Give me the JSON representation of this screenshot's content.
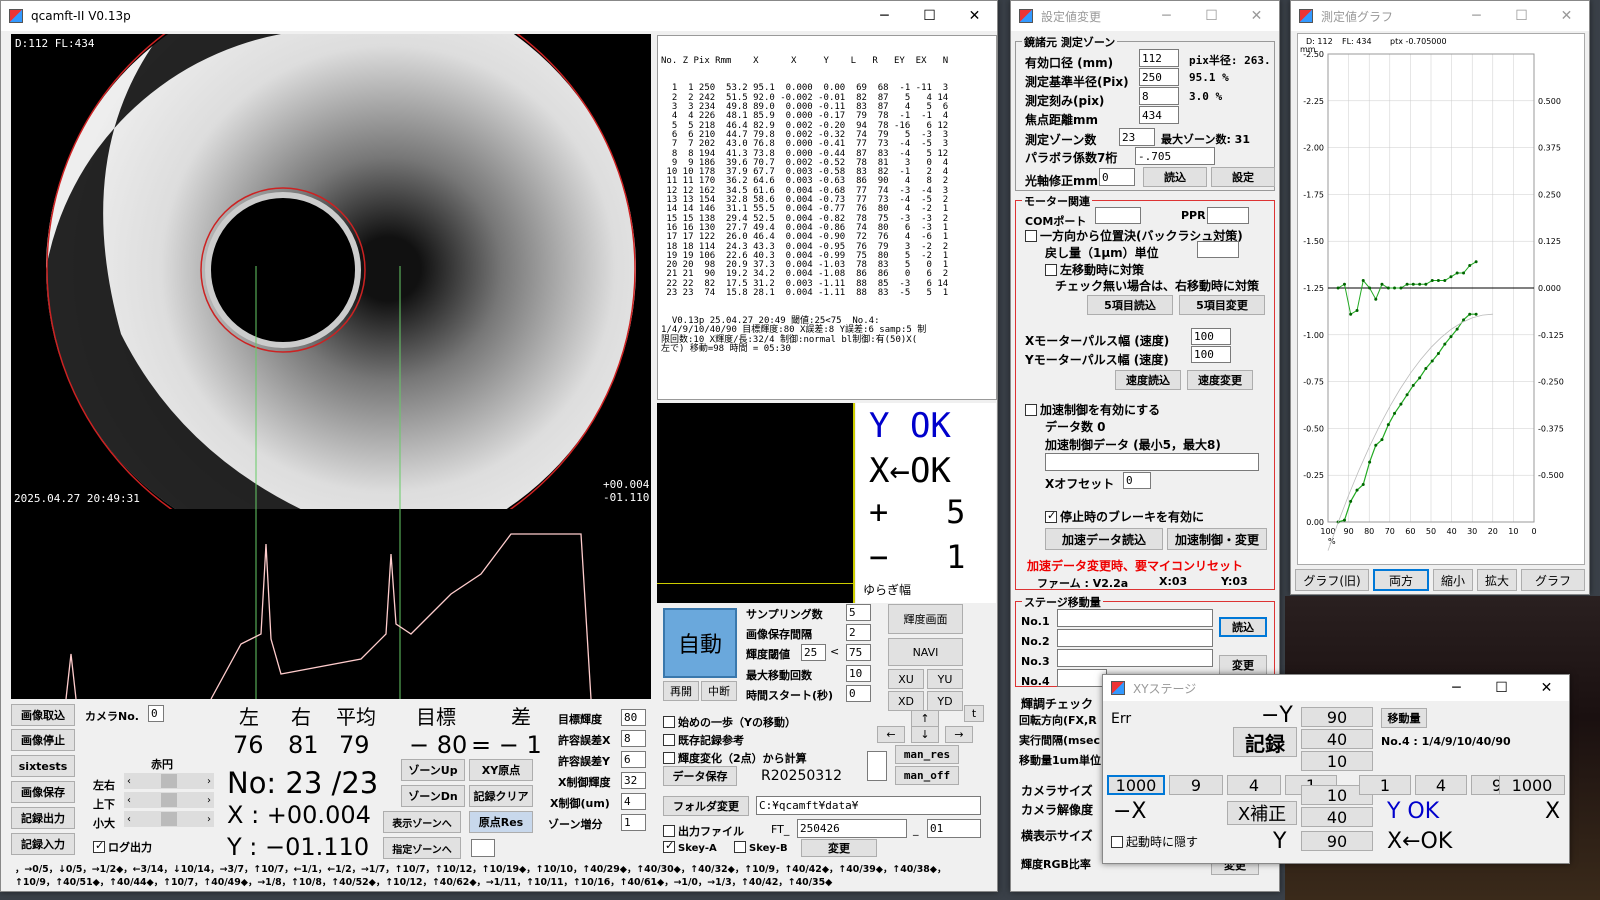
{
  "main": {
    "title": "qcamft-II  V0.13p",
    "cam_overlay": "D:112 FL:434",
    "timestamp": "2025.04.27 20:49:31",
    "xy_overlay1": "+00.004",
    "xy_overlay2": "-01.110",
    "table_header": "No. Z Pix Rmm    X      X     Y    L   R   EY  EX   N",
    "table_rows": [
      "  1  1 250  53.2 95.1  0.000  0.00  69  68  -1 -11  3",
      "  2  2 242  51.5 92.0 -0.002 -0.01  82  87   5   4 14",
      "  3  3 234  49.8 89.0  0.000 -0.11  83  87   4   5  6",
      "  4  4 226  48.1 85.9  0.000 -0.17  79  78  -1  -1  4",
      "  5  5 218  46.4 82.9  0.002 -0.20  94  78 -16   6 12",
      "  6  6 210  44.7 79.8  0.002 -0.32  74  79   5  -3  3",
      "  7  7 202  43.0 76.8  0.000 -0.41  77  73  -4  -5  3",
      "  8  8 194  41.3 73.8  0.000 -0.44  87  83  -4   5 12",
      "  9  9 186  39.6 70.7  0.002 -0.52  78  81   3   0  4",
      " 10 10 178  37.9 67.7  0.003 -0.58  83  82  -1   2  4",
      " 11 11 170  36.2 64.6  0.003 -0.63  86  90   4   8  2",
      " 12 12 162  34.5 61.6  0.004 -0.68  77  74  -3  -4  3",
      " 13 13 154  32.8 58.6  0.004 -0.73  77  73  -4  -5  2",
      " 14 14 146  31.1 55.5  0.004 -0.77  76  80   4  -2  1",
      " 15 15 138  29.4 52.5  0.004 -0.82  78  75  -3  -3  2",
      " 16 16 130  27.7 49.4  0.004 -0.86  74  80   6  -3  1",
      " 17 17 122  26.0 46.4  0.004 -0.90  72  76   4  -6  1",
      " 18 18 114  24.3 43.3  0.004 -0.95  76  79   3  -2  2",
      " 19 19 106  22.6 40.3  0.004 -0.99  75  80   5  -2  1",
      " 20 20  98  20.9 37.3  0.004 -1.03  78  83   5   0  1",
      " 21 21  90  19.2 34.2  0.004 -1.08  86  86   0   6  2",
      " 22 22  82  17.5 31.2  0.003 -1.11  88  85  -3   6 14",
      " 23 23  74  15.8 28.1  0.004 -1.11  88  83  -5   5  1"
    ],
    "table_footer": [
      "  V0.13p 25.04.27 20:49 閾値:25<75  No.4:",
      "1/4/9/10/40/90 目標輝度:80 X誤差:8 Y誤差:6 samp:5 制",
      "限回数:10 X輝度/長:32/4 制御:normal bl制御:有(50)X(",
      "左で) 移動=98 時間 = 05:30"
    ],
    "status_y": "Y OK",
    "status_x": "X←OK",
    "plus": "+   5",
    "minus": "−   1",
    "yuragi": "ゆらぎ幅",
    "auto": "自動",
    "restart": "再開",
    "pause": "中断",
    "sampling": "サンプリング数",
    "sampling_v": "5",
    "imgint": "画像保存間隔",
    "imgint_v": "2",
    "thr": "輝度閾値",
    "thr_a": "25",
    "thr_b": "75",
    "maxmove": "最大移動回数",
    "maxmove_v": "10",
    "timestart": "時間スタート(秒)",
    "timestart_v": "0",
    "brightscr": "輝度画面",
    "navi": "NAVI",
    "xu": "XU",
    "yu": "YU",
    "xd": "XD",
    "yd": "YD",
    "cap": "画像取込",
    "stop": "画像停止",
    "sixtests": "sixtests",
    "save": "画像保存",
    "recout": "記録出力",
    "recin": "記録入力",
    "camno": "カメラNo.",
    "camno_v": "0",
    "sekien": "赤円",
    "lr": "左右",
    "ud": "上下",
    "sz": "小大",
    "logout": "ログ出力",
    "h_left": "左",
    "h_right": "右",
    "h_avg": "平均",
    "h_target": "目標",
    "h_diff": "差",
    "v_left": "76",
    "v_right": "81",
    "v_avg": "79",
    "v_target": "− 80",
    "v_diff": "= − 1",
    "no": "No: 23 /23",
    "x": "X : +00.004",
    "y": "Y : −01.110",
    "zoneup": "ゾーンUp",
    "zonedn": "ゾーンDn",
    "xyorig": "XY原点",
    "recclr": "記録クリア",
    "showzone": "表示ゾーンへ",
    "origres": "原点Res",
    "specz": "指定ゾーンへ",
    "tb": "目標輝度",
    "tb_v": "80",
    "ex": "許容誤差X",
    "ex_v": "8",
    "ey": "許容誤差Y",
    "ey_v": "6",
    "xc": "X制御輝度",
    "xc_v": "32",
    "xcu": "X制御(um)",
    "xcu_v": "4",
    "zinc": "ゾーン増分",
    "zinc_v": "1",
    "first": "始めの一歩（Yの移動）",
    "exist": "既存記録参考",
    "bchg": "輝度変化（2点）から計算",
    "datasave": "データ保存",
    "rdate": "R20250312",
    "manres": "man_res",
    "manoff": "man_off",
    "up": "↑",
    "dn": "↓",
    "lf": "←",
    "rt": "→",
    "t": "t",
    "folder": "フォルダ変更",
    "folder_v": "C:¥qcamft¥data¥",
    "outfile": "出力ファイル",
    "ft": "FT_",
    "ft_v": "250426",
    "ft_n": "01",
    "skeya": "Skey-A",
    "skeyb": "Skey-B",
    "change": "変更",
    "log": "，→0/5，↓0/5，→1/2◆，←3/14，↓10/14，→3/7，↑10/7，←1/1，←1/2，→1/7，↑10/7，↑10/12，↑10/19◆，↑10/10，↑40/29◆，↑40/30◆，↑40/32◆，↑10/9，↑40/42◆，↑40/39◆，↑40/38◆，↑10/9，↑40/51◆，↑40/44◆，↑10/7，↑40/49◆，→1/8，↑10/8，↑40/52◆，↑10/12，↑40/62◆，→1/11，↑10/11，↑10/16，↑40/61◆，→1/0，→1/3，↑40/42，↑40/35◆"
  },
  "settings": {
    "title": "設定値変更",
    "g1": "鏡諸元 測定ゾーン",
    "eff": "有効口径 (mm)",
    "eff_v": "112",
    "pixr": "pix半径: 263.",
    "base": "測定基準半径(Pix)",
    "base_v": "250",
    "base_p": "95.1 %",
    "step": "測定刻み(pix)",
    "step_v": "8",
    "step_p": "3.0 %",
    "fl": "焦点距離mm",
    "fl_v": "434",
    "zones": "測定ゾーン数",
    "zones_v": "23",
    "maxz": "最大ゾーン数:  31",
    "para": "パラボラ係数7桁",
    "para_v": "-.705",
    "axis": "光軸修正mm",
    "axis_v": "0",
    "read": "読込",
    "set": "設定",
    "g2": "モーター関連",
    "com": "COMポート",
    "ppr": "PPR",
    "oneway": "一方向から位置決(バックラシュ対策)",
    "ret": "戻し量（1μm）単位",
    "leftmv": "左移動時に対策",
    "note": "チェック無い場合は、右移動時に対策",
    "r5": "5項目読込",
    "c5": "5項目変更",
    "xpw": "Xモーターパルス幅 (速度)",
    "xpw_v": "100",
    "ypw": "Yモーターパルス幅 (速度)",
    "ypw_v": "100",
    "spr": "速度読込",
    "spc": "速度変更",
    "accel": "加速制御を有効にする",
    "dcount": "データ数  0",
    "adata": "加速制御データ (最小5，最大8)",
    "xoff": "Xオフセット",
    "xoff_v": "0",
    "brake": "停止時のブレーキを有効に",
    "ard": "加速データ読込",
    "acc": "加速制御・変更",
    "warn": "加速データ変更時、要マイコンリセット",
    "firm": "ファーム : V2.2a",
    "x03": "X:03",
    "y03": "Y:03",
    "g3": "ステージ移動量",
    "n1": "No.1",
    "n2": "No.2",
    "n3": "No.3",
    "n4": "No.4",
    "sread": "読込",
    "schg": "変更",
    "g4": "輝調チェック",
    "rot": "回転方向(FX,R",
    "intv": "実行間隔(msec",
    "unit": "移動量1um単位",
    "g5": "カメラサイズ",
    "res": "カメラ解像度",
    "hsz": "横表示サイズ",
    "rgb": "輝度RGB比率",
    "chg2": "変更"
  },
  "graph": {
    "title": "測定値グラフ",
    "hdr1": "D: 112",
    "hdr2": "FL: 434",
    "hdr3": "ptx -0.705000",
    "mm": "mm",
    "pct": "%",
    "yl": [
      "-2.50",
      "-2.25",
      "-2.00",
      "-1.75",
      "-1.50",
      "-1.25",
      "-1.00",
      "-0.75",
      "-0.50",
      "-0.25",
      "0.00"
    ],
    "yr": [
      "0.500",
      "0.375",
      "0.250",
      "0.125",
      "0.000",
      "-0.125",
      "-0.250",
      "-0.375",
      "-0.500"
    ],
    "xl": [
      "100",
      "90",
      "80",
      "70",
      "60",
      "50",
      "40",
      "30",
      "20",
      "10",
      "0"
    ],
    "b1": "グラフ(旧)",
    "b2": "両方",
    "b3": "縮小",
    "b4": "拡大",
    "b5": "グラフ"
  },
  "xy": {
    "title": "XYステージ",
    "err": "Err",
    "my": "−Y",
    "my_v": "90",
    "mv": "移動量",
    "v40": "40",
    "v10": "10",
    "rec": "記録",
    "no4": "No.4 :  1/4/9/10/40/90",
    "l1000": "1000",
    "l9": "9",
    "l4": "4",
    "l1": "1",
    "r1": "1",
    "r4": "4",
    "r9": "9",
    "r1000": "1000",
    "mx": "−X",
    "xcor": "X補正",
    "yok": "Y OK",
    "xlab": "X",
    "b10": "10",
    "b40": "40",
    "hide": "起動時に隠す",
    "ylab": "Y",
    "b90": "90",
    "xok": "X←OK"
  },
  "chart_data": {
    "type": "line",
    "x": [
      95.1,
      92.0,
      89.0,
      85.9,
      82.9,
      79.8,
      76.8,
      73.8,
      70.7,
      67.7,
      64.6,
      61.6,
      58.6,
      55.5,
      52.5,
      49.4,
      46.4,
      43.3,
      40.3,
      37.3,
      34.2,
      31.2,
      28.1
    ],
    "series": [
      {
        "values": [
          0.0,
          -0.01,
          -0.11,
          -0.17,
          -0.2,
          -0.32,
          -0.41,
          -0.44,
          -0.52,
          -0.58,
          -0.63,
          -0.68,
          -0.73,
          -0.77,
          -0.82,
          -0.86,
          -0.9,
          -0.95,
          -0.99,
          -1.03,
          -1.08,
          -1.11,
          -1.11
        ]
      }
    ],
    "xlim": [
      100,
      0
    ],
    "ylim": [
      0,
      -2.5
    ]
  }
}
